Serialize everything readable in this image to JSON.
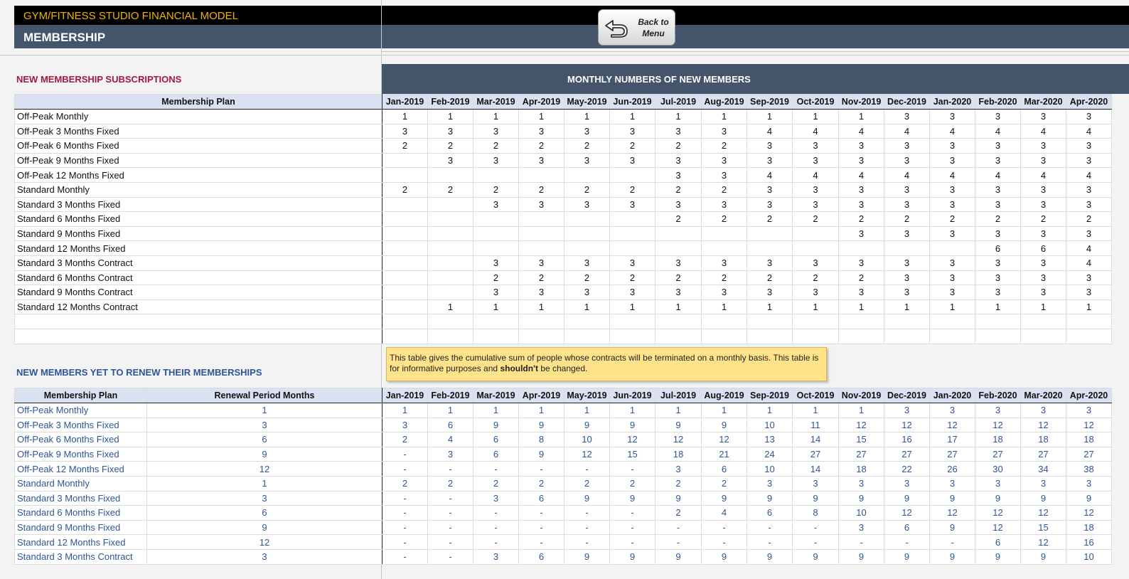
{
  "header": {
    "app_title": "GYM/FITNESS STUDIO FINANCIAL MODEL",
    "page_title": "MEMBERSHIP",
    "back_button": "Back to Menu"
  },
  "section1": {
    "title": "NEW MEMBERSHIP SUBSCRIPTIONS",
    "banner": "MONTHLY NUMBERS OF NEW MEMBERS",
    "plan_header": "Membership Plan"
  },
  "section2": {
    "title": "NEW MEMBERS YET TO RENEW THEIR MEMBERSHIPS",
    "plan_header": "Membership Plan",
    "renewal_header": "Renewal Period Months",
    "note_plain": "This table gives the cumulative sum of people whose contracts will be terminated on a monthly basis. This table is for informative purposes and",
    "note_bold": "shouldn't",
    "note_tail": "be changed."
  },
  "months": [
    "Jan-2019",
    "Feb-2019",
    "Mar-2019",
    "Apr-2019",
    "May-2019",
    "Jun-2019",
    "Jul-2019",
    "Aug-2019",
    "Sep-2019",
    "Oct-2019",
    "Nov-2019",
    "Dec-2019",
    "Jan-2020",
    "Feb-2020",
    "Mar-2020",
    "Apr-2020"
  ],
  "new_members": [
    {
      "plan": "Off-Peak Monthly",
      "values": [
        "1",
        "1",
        "1",
        "1",
        "1",
        "1",
        "1",
        "1",
        "1",
        "1",
        "1",
        "3",
        "3",
        "3",
        "3",
        "3"
      ]
    },
    {
      "plan": "Off-Peak 3 Months Fixed",
      "values": [
        "3",
        "3",
        "3",
        "3",
        "3",
        "3",
        "3",
        "3",
        "4",
        "4",
        "4",
        "4",
        "4",
        "4",
        "4",
        "4"
      ]
    },
    {
      "plan": "Off-Peak 6 Months Fixed",
      "values": [
        "2",
        "2",
        "2",
        "2",
        "2",
        "2",
        "2",
        "2",
        "3",
        "3",
        "3",
        "3",
        "3",
        "3",
        "3",
        "3"
      ]
    },
    {
      "plan": "Off-Peak 9 Months Fixed",
      "values": [
        "",
        "3",
        "3",
        "3",
        "3",
        "3",
        "3",
        "3",
        "3",
        "3",
        "3",
        "3",
        "3",
        "3",
        "3",
        "3"
      ]
    },
    {
      "plan": "Off-Peak 12 Months Fixed",
      "values": [
        "",
        "",
        "",
        "",
        "",
        "",
        "3",
        "3",
        "4",
        "4",
        "4",
        "4",
        "4",
        "4",
        "4",
        "4"
      ]
    },
    {
      "plan": "Standard Monthly",
      "values": [
        "2",
        "2",
        "2",
        "2",
        "2",
        "2",
        "2",
        "2",
        "3",
        "3",
        "3",
        "3",
        "3",
        "3",
        "3",
        "3"
      ]
    },
    {
      "plan": "Standard 3 Months Fixed",
      "values": [
        "",
        "",
        "3",
        "3",
        "3",
        "3",
        "3",
        "3",
        "3",
        "3",
        "3",
        "3",
        "3",
        "3",
        "3",
        "3"
      ]
    },
    {
      "plan": "Standard 6 Months Fixed",
      "values": [
        "",
        "",
        "",
        "",
        "",
        "",
        "2",
        "2",
        "2",
        "2",
        "2",
        "2",
        "2",
        "2",
        "2",
        "2"
      ]
    },
    {
      "plan": "Standard 9 Months Fixed",
      "values": [
        "",
        "",
        "",
        "",
        "",
        "",
        "",
        "",
        "",
        "",
        "3",
        "3",
        "3",
        "3",
        "3",
        "3"
      ]
    },
    {
      "plan": "Standard 12 Months Fixed",
      "values": [
        "",
        "",
        "",
        "",
        "",
        "",
        "",
        "",
        "",
        "",
        "",
        "",
        "",
        "6",
        "6",
        "4"
      ]
    },
    {
      "plan": "Standard 3 Months Contract",
      "values": [
        "",
        "",
        "3",
        "3",
        "3",
        "3",
        "3",
        "3",
        "3",
        "3",
        "3",
        "3",
        "3",
        "3",
        "3",
        "4"
      ]
    },
    {
      "plan": "Standard 6 Months Contract",
      "values": [
        "",
        "",
        "2",
        "2",
        "2",
        "2",
        "2",
        "2",
        "2",
        "2",
        "2",
        "3",
        "3",
        "3",
        "3",
        "3"
      ]
    },
    {
      "plan": "Standard 9 Months Contract",
      "values": [
        "",
        "",
        "3",
        "3",
        "3",
        "3",
        "3",
        "3",
        "3",
        "3",
        "3",
        "3",
        "3",
        "3",
        "3",
        "3"
      ]
    },
    {
      "plan": "Standard 12 Months Contract",
      "values": [
        "",
        "1",
        "1",
        "1",
        "1",
        "1",
        "1",
        "1",
        "1",
        "1",
        "1",
        "1",
        "1",
        "1",
        "1",
        "1"
      ]
    },
    {
      "plan": "",
      "values": [
        "",
        "",
        "",
        "",
        "",
        "",
        "",
        "",
        "",
        "",
        "",
        "",
        "",
        "",
        "",
        ""
      ]
    },
    {
      "plan": "",
      "values": [
        "",
        "",
        "",
        "",
        "",
        "",
        "",
        "",
        "",
        "",
        "",
        "",
        "",
        "",
        "",
        ""
      ]
    }
  ],
  "renewals": [
    {
      "plan": "Off-Peak Monthly",
      "period": "1",
      "values": [
        "1",
        "1",
        "1",
        "1",
        "1",
        "1",
        "1",
        "1",
        "1",
        "1",
        "1",
        "3",
        "3",
        "3",
        "3",
        "3"
      ]
    },
    {
      "plan": "Off-Peak 3 Months Fixed",
      "period": "3",
      "values": [
        "3",
        "6",
        "9",
        "9",
        "9",
        "9",
        "9",
        "9",
        "10",
        "11",
        "12",
        "12",
        "12",
        "12",
        "12",
        "12"
      ]
    },
    {
      "plan": "Off-Peak 6 Months Fixed",
      "period": "6",
      "values": [
        "2",
        "4",
        "6",
        "8",
        "10",
        "12",
        "12",
        "12",
        "13",
        "14",
        "15",
        "16",
        "17",
        "18",
        "18",
        "18"
      ]
    },
    {
      "plan": "Off-Peak 9 Months Fixed",
      "period": "9",
      "values": [
        "-",
        "3",
        "6",
        "9",
        "12",
        "15",
        "18",
        "21",
        "24",
        "27",
        "27",
        "27",
        "27",
        "27",
        "27",
        "27"
      ]
    },
    {
      "plan": "Off-Peak 12 Months Fixed",
      "period": "12",
      "values": [
        "-",
        "-",
        "-",
        "-",
        "-",
        "-",
        "3",
        "6",
        "10",
        "14",
        "18",
        "22",
        "26",
        "30",
        "34",
        "38"
      ]
    },
    {
      "plan": "Standard Monthly",
      "period": "1",
      "values": [
        "2",
        "2",
        "2",
        "2",
        "2",
        "2",
        "2",
        "2",
        "3",
        "3",
        "3",
        "3",
        "3",
        "3",
        "3",
        "3"
      ]
    },
    {
      "plan": "Standard 3 Months Fixed",
      "period": "3",
      "values": [
        "-",
        "-",
        "3",
        "6",
        "9",
        "9",
        "9",
        "9",
        "9",
        "9",
        "9",
        "9",
        "9",
        "9",
        "9",
        "9"
      ]
    },
    {
      "plan": "Standard 6 Months Fixed",
      "period": "6",
      "values": [
        "-",
        "-",
        "-",
        "-",
        "-",
        "-",
        "2",
        "4",
        "6",
        "8",
        "10",
        "12",
        "12",
        "12",
        "12",
        "12"
      ]
    },
    {
      "plan": "Standard 9 Months Fixed",
      "period": "9",
      "values": [
        "-",
        "-",
        "-",
        "-",
        "-",
        "-",
        "-",
        "-",
        "-",
        "-",
        "3",
        "6",
        "9",
        "12",
        "15",
        "18"
      ]
    },
    {
      "plan": "Standard 12 Months Fixed",
      "period": "12",
      "values": [
        "-",
        "-",
        "-",
        "-",
        "-",
        "-",
        "-",
        "-",
        "-",
        "-",
        "-",
        "-",
        "-",
        "6",
        "12",
        "16"
      ]
    },
    {
      "plan": "Standard 3 Months Contract",
      "period": "3",
      "values": [
        "-",
        "-",
        "3",
        "6",
        "9",
        "9",
        "9",
        "9",
        "9",
        "9",
        "9",
        "9",
        "9",
        "9",
        "9",
        "10"
      ]
    }
  ],
  "colors": {
    "header_black": "#000000",
    "header_title": "#f0b400",
    "header_blue": "#44546a",
    "section1_title": "#a01c3c",
    "section2_title": "#2f5597",
    "table_header": "#d9e1f2",
    "note_bg": "#ffe28a"
  }
}
